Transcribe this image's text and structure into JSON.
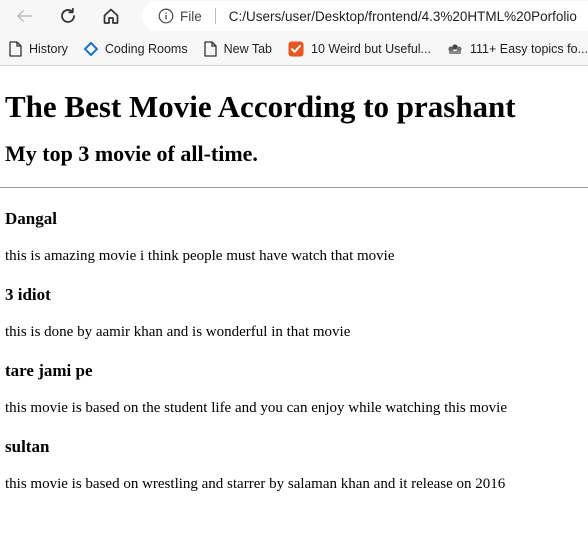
{
  "browser": {
    "address": {
      "scheme": "File",
      "url": "C:/Users/user/Desktop/frontend/4.3%20HTML%20Porfolio"
    },
    "bookmarks": [
      {
        "label": "History",
        "icon": "page-icon"
      },
      {
        "label": "Coding Rooms",
        "icon": "coding-rooms-icon"
      },
      {
        "label": "New Tab",
        "icon": "page-icon"
      },
      {
        "label": "10 Weird but Useful...",
        "icon": "checkbox-orange-icon"
      },
      {
        "label": "111+ Easy topics fo...",
        "icon": "site-icon"
      }
    ]
  },
  "page": {
    "title": "The Best Movie According to prashant",
    "subtitle": "My top 3 movie of all-time.",
    "movies": [
      {
        "name": "Dangal",
        "description": "this is amazing movie i think people must have watch that movie"
      },
      {
        "name": "3 idiot",
        "description": "this is done by aamir khan and is wonderful in that movie"
      },
      {
        "name": "tare jami pe",
        "description": "this movie is based on the student life and you can enjoy while watching this movie"
      },
      {
        "name": "sultan",
        "description": "this movie is based on wrestling and starrer by salaman khan and it release on 2016"
      }
    ]
  },
  "colors": {
    "chrome_bg": "#f7f7f7",
    "accent_orange": "#e8561f",
    "coding_rooms_blue": "#1a73c8"
  }
}
